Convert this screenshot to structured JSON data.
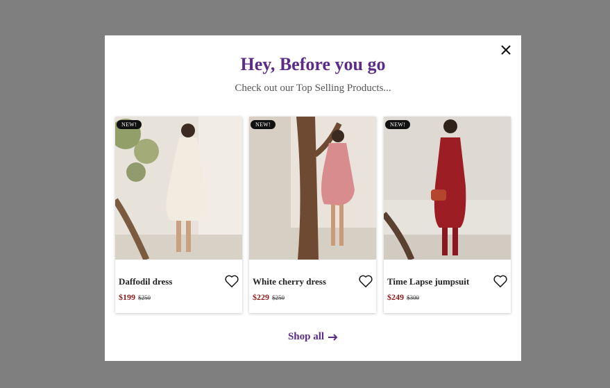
{
  "popup": {
    "title": "Hey, Before you go",
    "subtitle": "Check out our Top Selling Products...",
    "shop_all": "Shop all",
    "accent_color": "#5b2d86",
    "price_color": "#8b1a1a"
  },
  "products": [
    {
      "badge": "NEW!",
      "name": "Daffodil dress",
      "price": "$199",
      "old_price": "$250"
    },
    {
      "badge": "NEW!",
      "name": "White cherry dress",
      "price": "$229",
      "old_price": "$250"
    },
    {
      "badge": "NEW!",
      "name": "Time Lapse jumpsuit",
      "price": "$249",
      "old_price": "$300"
    }
  ]
}
